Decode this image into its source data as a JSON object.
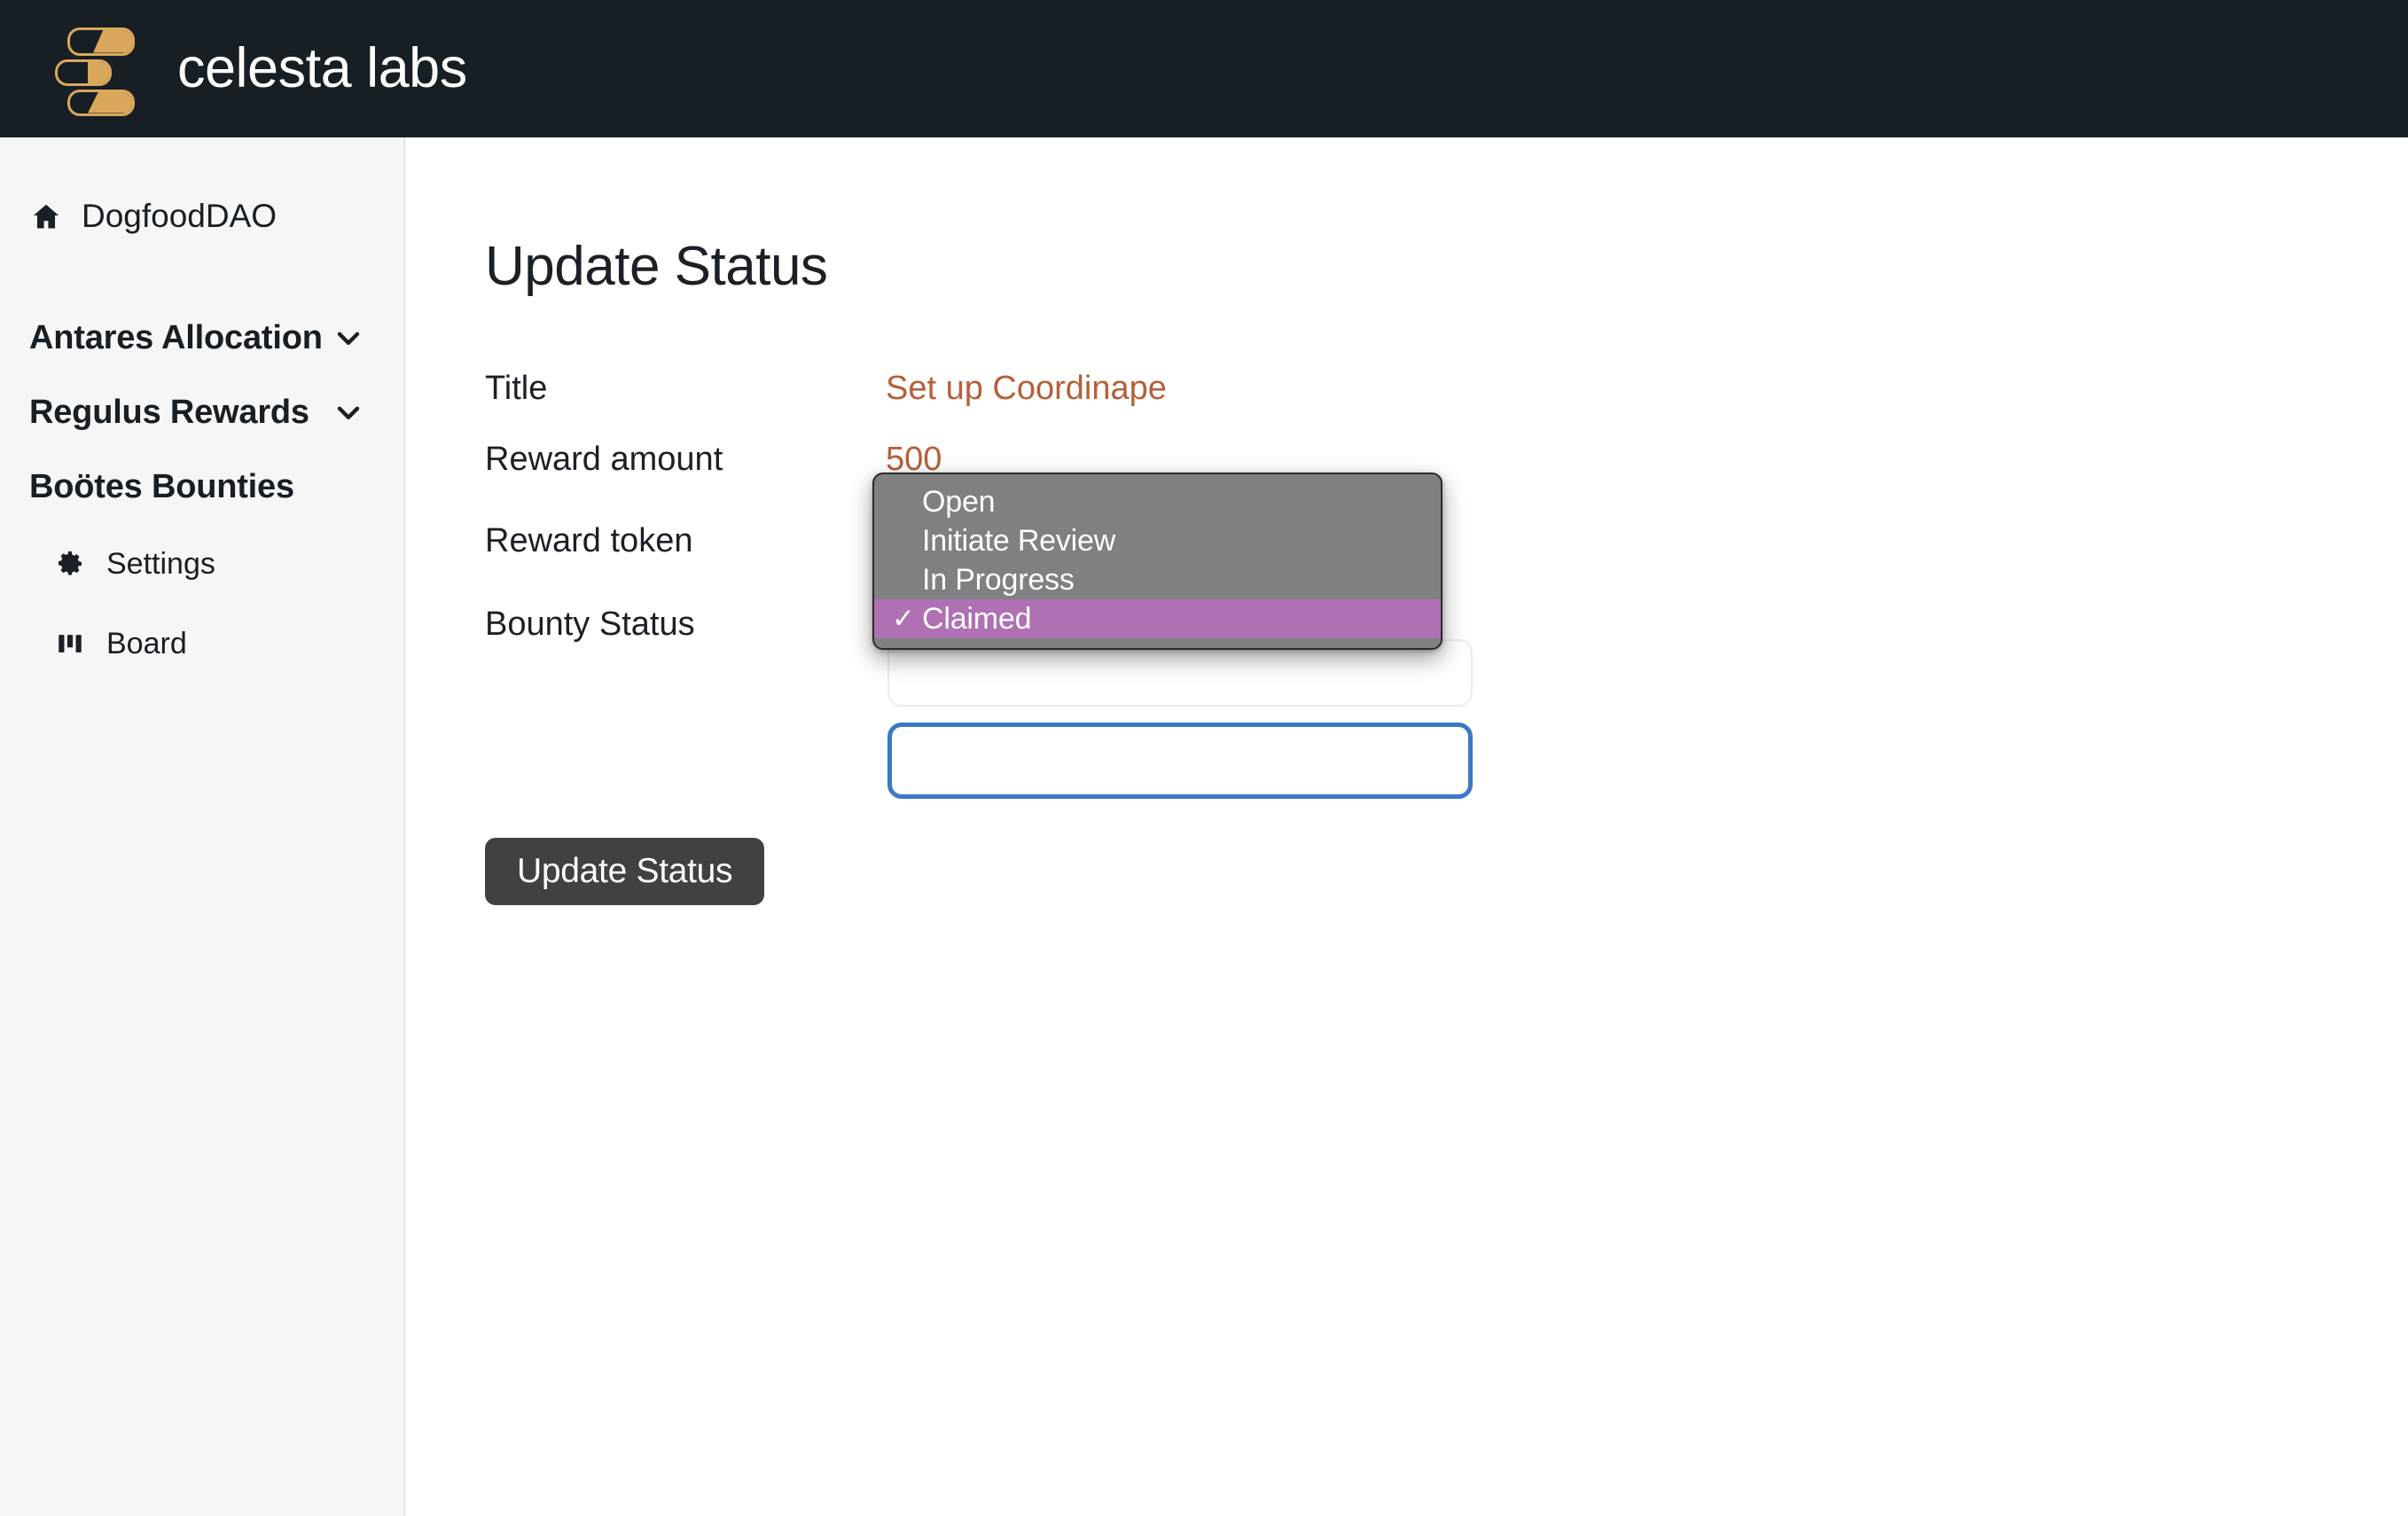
{
  "brand": {
    "name": "celesta labs",
    "logo_icon": "celesta-stacked-bars-logo",
    "header_bg": "#171e24",
    "logo_gold": "#d9a85c"
  },
  "sidebar": {
    "home": {
      "label": "DogfoodDAO",
      "icon": "home-icon"
    },
    "groups": [
      {
        "label": "Antares Allocation",
        "icon": "chevron-down-icon"
      },
      {
        "label": "Regulus Rewards",
        "icon": "chevron-down-icon"
      }
    ],
    "section": {
      "label": "Boötes Bounties"
    },
    "sub_items": [
      {
        "label": "Settings",
        "icon": "gear-icon"
      },
      {
        "label": "Board",
        "icon": "kanban-board-icon"
      }
    ]
  },
  "main": {
    "title": "Update Status",
    "fields": [
      {
        "label": "Title",
        "value": "Set up Coordinape"
      },
      {
        "label": "Reward amount",
        "value": "500"
      },
      {
        "label": "Reward token",
        "value": ""
      },
      {
        "label": "Bounty Status",
        "value": ""
      }
    ],
    "submit_label": "Update Status",
    "value_color": "#b56039",
    "focus_border_color": "#3b78c8"
  },
  "dropdown": {
    "name": "bounty-status-options",
    "selected_index": 3,
    "highlight_color": "#b070b4",
    "background_color": "#808080",
    "check_glyph": "✓",
    "options": [
      {
        "label": "Open"
      },
      {
        "label": "Initiate Review"
      },
      {
        "label": "In Progress"
      },
      {
        "label": "Claimed"
      }
    ]
  }
}
